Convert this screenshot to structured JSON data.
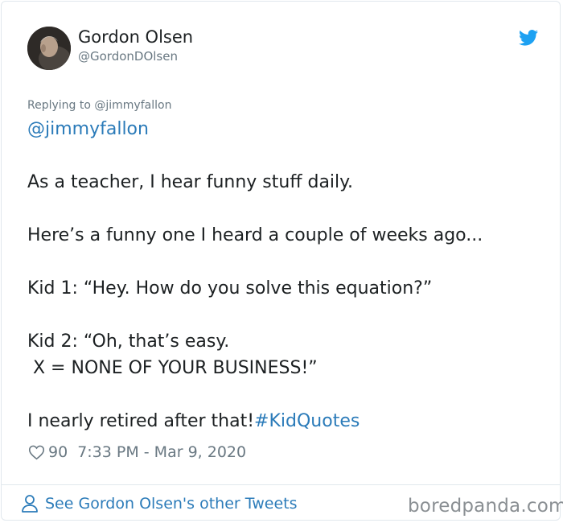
{
  "author": {
    "display_name": "Gordon Olsen",
    "handle": "@GordonDOlsen",
    "avatar_icon": "user-avatar-photo"
  },
  "brand": {
    "icon": "twitter-bird-icon",
    "color": "#1da1f2"
  },
  "tweet": {
    "replying_to": "Replying to @jimmyfallon",
    "mention": "@jimmyfallon",
    "line_1": "As a teacher, I hear funny stuff daily.",
    "line_2": "Here’s a funny one I heard a couple of weeks ago...",
    "line_3": "Kid 1: “Hey. How do you solve this equation?”",
    "line_4": "Kid 2: “Oh, that’s easy.",
    "line_5": " X = NONE OF YOUR BUSINESS!”",
    "line_6": "I nearly retired after that!",
    "hashtag": "#KidQuotes",
    "link_color": "#2b7bb9"
  },
  "meta": {
    "like_icon": "heart-icon",
    "likes": "90",
    "timestamp": "7:33 PM - Mar 9, 2020"
  },
  "footer": {
    "icon": "person-icon",
    "see_more_label": "See Gordon Olsen's other Tweets"
  },
  "watermark": "boredpanda.com"
}
